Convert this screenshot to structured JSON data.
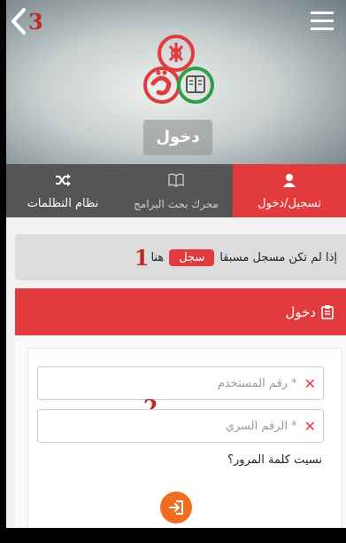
{
  "header": {
    "back_number": "3",
    "login_tag": "دخول"
  },
  "tabs": [
    {
      "label": "تسجيل/دخول",
      "icon": "user-icon",
      "active": true
    },
    {
      "label": "محرك بحث البرامج",
      "icon": "book-icon",
      "active": false
    },
    {
      "label": "نظام التظلمات",
      "icon": "shuffle-icon",
      "active": false
    }
  ],
  "notice": {
    "text": "إذا لم تكن مسجل مسبقا",
    "register_label": "سجل",
    "suffix": "هنا",
    "number": "1"
  },
  "panel": {
    "title": "دخول",
    "username_placeholder": "* رقم المستخدم",
    "password_placeholder": "* الرقم السري",
    "marker_number": "2",
    "forgot_label": "نسيت كلمة المرور؟"
  },
  "colors": {
    "accent": "#e13b3e",
    "tab_bg": "#555558",
    "submit": "#f26d1f",
    "marker": "#c0282b"
  }
}
